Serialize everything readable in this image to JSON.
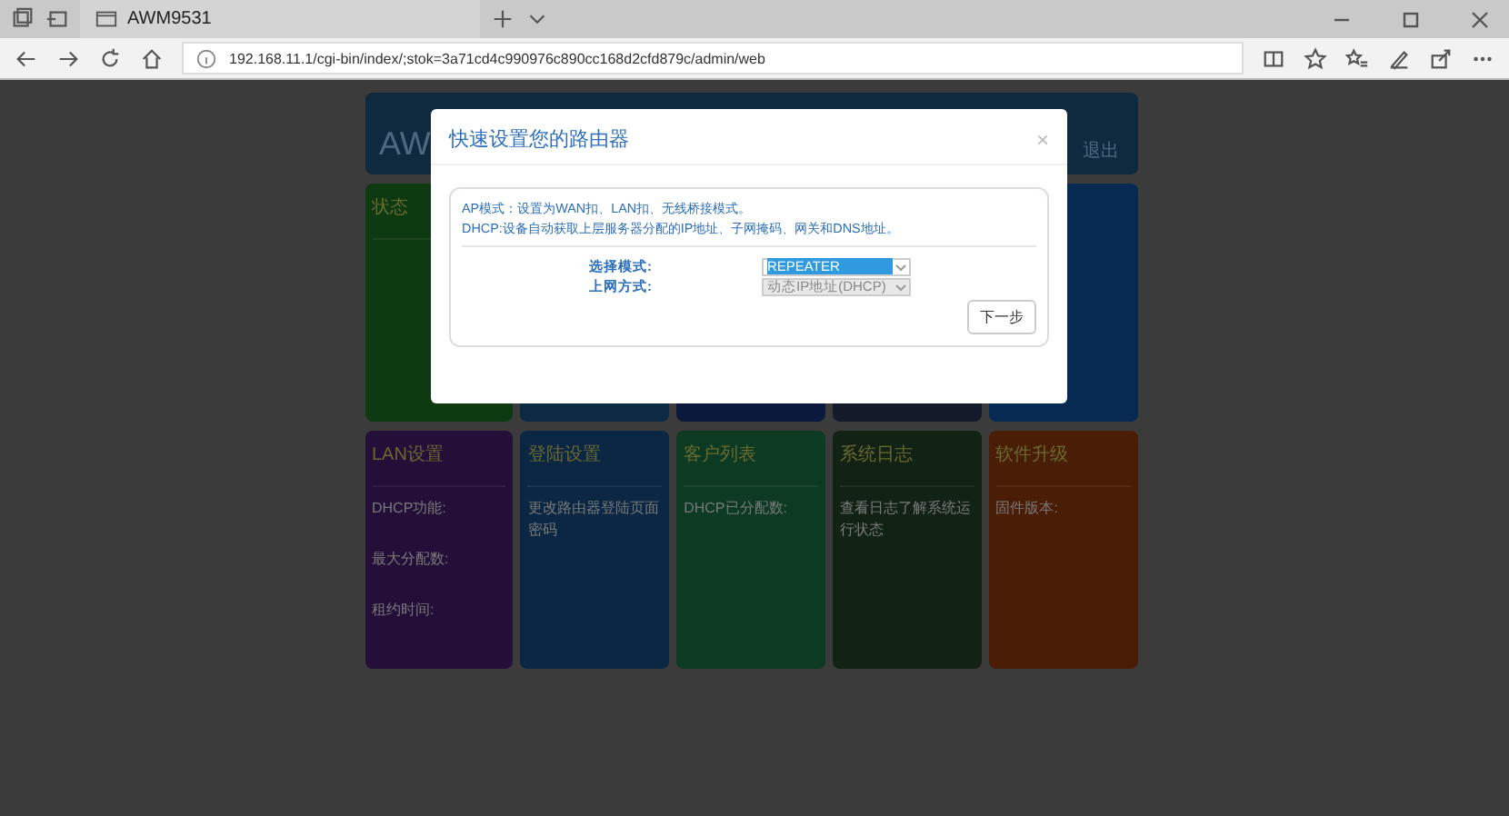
{
  "browser": {
    "tab_title": "AWM9531",
    "url": "192.168.11.1/cgi-bin/index/;stok=3a71cd4c990976c890cc168d2cfd879c/admin/web"
  },
  "dashboard": {
    "header_left": "AW",
    "header_right": "退出",
    "top_cards": [
      {
        "title": "状态",
        "color": "#0e3a12"
      },
      {
        "color": "#0d2a44"
      },
      {
        "color": "#0b1a3c"
      },
      {
        "color": "#141a2a"
      },
      {
        "color": "#062a52"
      }
    ],
    "cards": [
      {
        "title": "LAN设置",
        "color": "#230f38",
        "lines": [
          "DHCP功能:",
          "最大分配数:",
          "租约时间:"
        ]
      },
      {
        "title": "登陆设置",
        "color": "#0c2744",
        "lines": [
          "更改路由器登陆页面密码"
        ]
      },
      {
        "title": "客户列表",
        "color": "#0c3a22",
        "lines": [
          "DHCP已分配数:"
        ]
      },
      {
        "title": "系统日志",
        "color": "#122214",
        "lines": [
          "查看日志了解系统运行状态"
        ]
      },
      {
        "title": "软件升级",
        "color": "#4a1d06",
        "lines": [
          "固件版本:"
        ]
      }
    ]
  },
  "dialog": {
    "title": "快速设置您的路由器",
    "close": "×",
    "info": [
      "AP模式：设置为WAN扣、LAN扣、无线桥接模式。",
      "DHCP:设备自动获取上层服务器分配的IP地址、子网掩码、网关和DNS地址。"
    ],
    "fields": [
      {
        "label": "选择模式:",
        "value": "REPEATER",
        "disabled": false
      },
      {
        "label": "上网方式:",
        "value": "动态IP地址(DHCP)",
        "disabled": true
      }
    ],
    "button": "下一步"
  }
}
